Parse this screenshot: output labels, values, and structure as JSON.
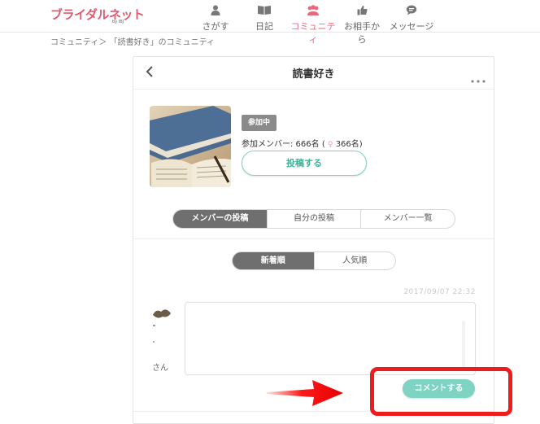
{
  "header": {
    "logo": "ブライダルネット",
    "logo_sub": "by IBJ",
    "nav": [
      {
        "label": "さがす",
        "icon": "person-icon"
      },
      {
        "label": "日記",
        "icon": "book-icon"
      },
      {
        "label": "コミュニティ",
        "icon": "group-icon",
        "active": true
      },
      {
        "label": "お相手から",
        "icon": "thumbs-up-icon"
      },
      {
        "label": "メッセージ",
        "icon": "chat-bubble-icon"
      }
    ]
  },
  "breadcrumb": "コミュニティ＞ 「読書好き」のコミュニティ",
  "community": {
    "title": "読書好き",
    "badge": "参加中",
    "members_label": "参加メンバー: 666名 (",
    "female_icon": "♀",
    "female_count": "366名)",
    "post_button": "投稿する",
    "image": "books-photo"
  },
  "tabs": [
    {
      "label": "メンバーの投稿",
      "active": true
    },
    {
      "label": "自分の投稿"
    },
    {
      "label": "メンバー一覧"
    }
  ],
  "sort": [
    {
      "label": "新着順",
      "active": true
    },
    {
      "label": "人気順"
    }
  ],
  "post": {
    "date": "2017/09/07 22:32",
    "username_suffix": "さん",
    "comment_button": "コメントする"
  },
  "colors": {
    "brand": "#e05a6f",
    "accent_nav": "#e8697e",
    "teal": "#7fd3c2",
    "highlight": "#ee1c1c"
  }
}
